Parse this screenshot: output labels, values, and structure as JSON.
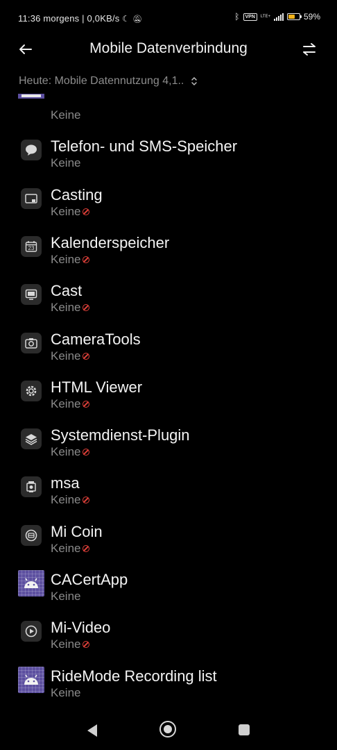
{
  "status_bar": {
    "time_text": "11:36 morgens | 0,0KB/s",
    "vpn_label": "VPN",
    "network_label": "LTE+",
    "battery_level": 0.59,
    "battery_text": "59%",
    "battery_color": "#f3b31a"
  },
  "header": {
    "title": "Mobile Datenverbindung",
    "back_icon": "arrow-left-icon",
    "sort_icon": "swap-arrows-icon"
  },
  "filter": {
    "label": "Heute: Mobile Datennutzung 4,1..",
    "icon": "up-down-chevron-icon"
  },
  "apps": [
    {
      "name": "",
      "usage": "Keine",
      "restricted": false,
      "icon": "purple-app-icon"
    },
    {
      "name": "Telefon- und SMS-Speicher",
      "usage": "Keine",
      "restricted": false,
      "icon": "chat-bubble-icon"
    },
    {
      "name": "Casting",
      "usage": "Keine",
      "restricted": true,
      "icon": "cast-screen-icon"
    },
    {
      "name": "Kalenderspeicher",
      "usage": "Keine",
      "restricted": true,
      "icon": "calendar-icon",
      "icon_text": "23"
    },
    {
      "name": "Cast",
      "usage": "Keine",
      "restricted": true,
      "icon": "monitor-icon"
    },
    {
      "name": "CameraTools",
      "usage": "Keine",
      "restricted": true,
      "icon": "camera-icon"
    },
    {
      "name": "HTML Viewer",
      "usage": "Keine",
      "restricted": true,
      "icon": "gear-icon"
    },
    {
      "name": "Systemdienst-Plugin",
      "usage": "Keine",
      "restricted": true,
      "icon": "layers-icon"
    },
    {
      "name": "msa",
      "usage": "Keine",
      "restricted": true,
      "icon": "msa-icon"
    },
    {
      "name": "Mi Coin",
      "usage": "Keine",
      "restricted": true,
      "icon": "coin-icon"
    },
    {
      "name": "CACertApp",
      "usage": "Keine",
      "restricted": false,
      "icon": "android-icon"
    },
    {
      "name": "Mi-Video",
      "usage": "Keine",
      "restricted": true,
      "icon": "play-icon"
    },
    {
      "name": "RideMode Recording list",
      "usage": "Keine",
      "restricted": false,
      "icon": "android-icon"
    }
  ],
  "colors": {
    "background": "#000000",
    "primary_text": "#f4f4f4",
    "secondary_text": "#8a8a8a",
    "restricted": "#e0403a",
    "android_icon_bg": "#5c4fa0"
  }
}
